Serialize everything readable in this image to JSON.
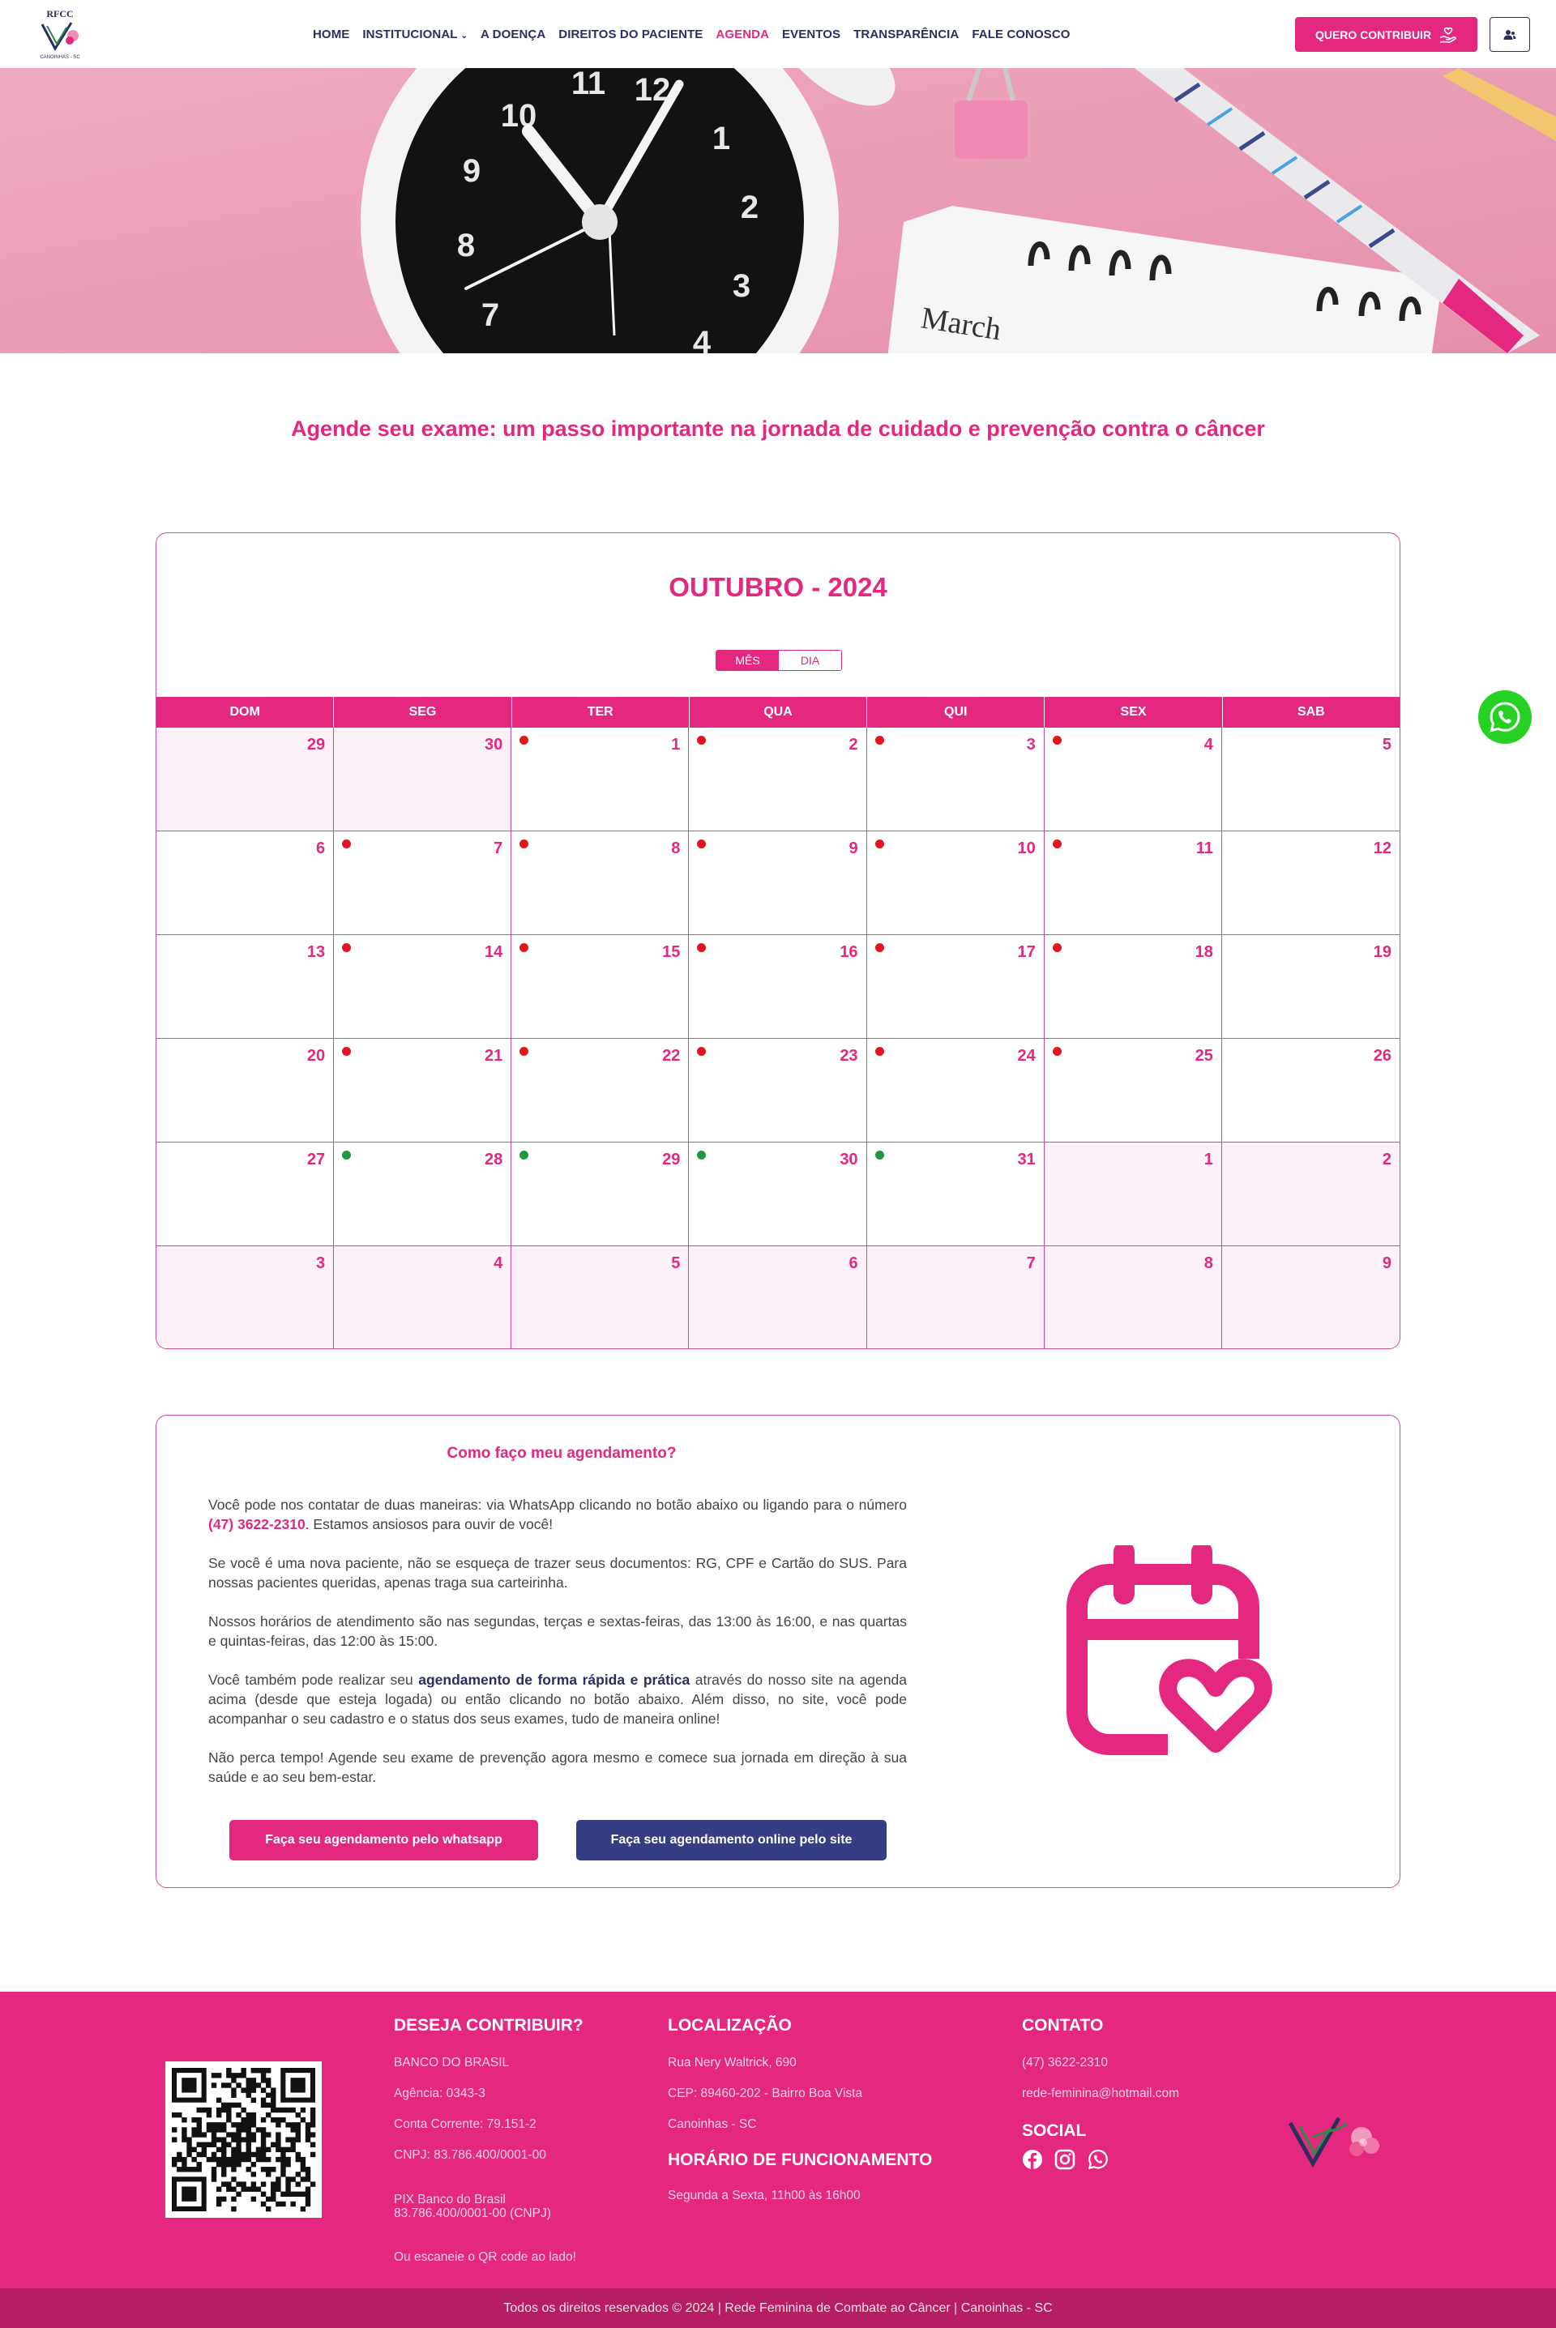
{
  "nav": {
    "items": [
      {
        "label": "HOME",
        "active": false,
        "has_dropdown": false
      },
      {
        "label": "INSTITUCIONAL",
        "active": false,
        "has_dropdown": true
      },
      {
        "label": "A DOENÇA",
        "active": false,
        "has_dropdown": false
      },
      {
        "label": "DIREITOS DO PACIENTE",
        "active": false,
        "has_dropdown": false
      },
      {
        "label": "AGENDA",
        "active": true,
        "has_dropdown": false
      },
      {
        "label": "EVENTOS",
        "active": false,
        "has_dropdown": false
      },
      {
        "label": "TRANSPARÊNCIA",
        "active": false,
        "has_dropdown": false
      },
      {
        "label": "FALE CONOSCO",
        "active": false,
        "has_dropdown": false
      }
    ],
    "contribute_label": "QUERO CONTRIBUIR"
  },
  "logo": {
    "text_top": "RFCC",
    "text_bottom": "CANOINHAS - SC"
  },
  "hero": {
    "calendar_month_text": "March"
  },
  "headline": "Agende seu exame: um passo importante na jornada de cuidado e prevenção contra o câncer",
  "calendar": {
    "title": "OUTUBRO - 2024",
    "views": [
      {
        "label": "MÊS",
        "active": true
      },
      {
        "label": "DIA",
        "active": false
      }
    ],
    "weekdays": [
      "DOM",
      "SEG",
      "TER",
      "QUA",
      "QUI",
      "SEX",
      "SAB"
    ],
    "dot_colors": {
      "red": "#e3141d",
      "green": "#1d9a3f"
    },
    "days": [
      {
        "n": "29",
        "muted": true,
        "dot": null
      },
      {
        "n": "30",
        "muted": true,
        "dot": null
      },
      {
        "n": "1",
        "muted": false,
        "dot": "red"
      },
      {
        "n": "2",
        "muted": false,
        "dot": "red"
      },
      {
        "n": "3",
        "muted": false,
        "dot": "red"
      },
      {
        "n": "4",
        "muted": false,
        "dot": "red"
      },
      {
        "n": "5",
        "muted": false,
        "dot": null
      },
      {
        "n": "6",
        "muted": false,
        "dot": null
      },
      {
        "n": "7",
        "muted": false,
        "dot": "red"
      },
      {
        "n": "8",
        "muted": false,
        "dot": "red"
      },
      {
        "n": "9",
        "muted": false,
        "dot": "red"
      },
      {
        "n": "10",
        "muted": false,
        "dot": "red"
      },
      {
        "n": "11",
        "muted": false,
        "dot": "red"
      },
      {
        "n": "12",
        "muted": false,
        "dot": null
      },
      {
        "n": "13",
        "muted": false,
        "dot": null
      },
      {
        "n": "14",
        "muted": false,
        "dot": "red"
      },
      {
        "n": "15",
        "muted": false,
        "dot": "red"
      },
      {
        "n": "16",
        "muted": false,
        "dot": "red"
      },
      {
        "n": "17",
        "muted": false,
        "dot": "red"
      },
      {
        "n": "18",
        "muted": false,
        "dot": "red"
      },
      {
        "n": "19",
        "muted": false,
        "dot": null
      },
      {
        "n": "20",
        "muted": false,
        "dot": null
      },
      {
        "n": "21",
        "muted": false,
        "dot": "red"
      },
      {
        "n": "22",
        "muted": false,
        "dot": "red"
      },
      {
        "n": "23",
        "muted": false,
        "dot": "red"
      },
      {
        "n": "24",
        "muted": false,
        "dot": "red"
      },
      {
        "n": "25",
        "muted": false,
        "dot": "red"
      },
      {
        "n": "26",
        "muted": false,
        "dot": null
      },
      {
        "n": "27",
        "muted": false,
        "dot": null
      },
      {
        "n": "28",
        "muted": false,
        "dot": "green"
      },
      {
        "n": "29",
        "muted": false,
        "dot": "green"
      },
      {
        "n": "30",
        "muted": false,
        "dot": "green"
      },
      {
        "n": "31",
        "muted": false,
        "dot": "green"
      },
      {
        "n": "1",
        "muted": true,
        "dot": null
      },
      {
        "n": "2",
        "muted": true,
        "dot": null
      },
      {
        "n": "3",
        "muted": true,
        "dot": null
      },
      {
        "n": "4",
        "muted": true,
        "dot": null
      },
      {
        "n": "5",
        "muted": true,
        "dot": null
      },
      {
        "n": "6",
        "muted": true,
        "dot": null
      },
      {
        "n": "7",
        "muted": true,
        "dot": null
      },
      {
        "n": "8",
        "muted": true,
        "dot": null
      },
      {
        "n": "9",
        "muted": true,
        "dot": null
      }
    ]
  },
  "info": {
    "title": "Como faço meu agendamento?",
    "p1_a": "Você pode nos contatar de duas maneiras: via WhatsApp clicando no botão abaixo ou ligando para o número ",
    "p1_phone": "(47) 3622-2310",
    "p1_b": ". Estamos ansiosos para ouvir de você!",
    "p2": "Se você é uma nova paciente, não se esqueça de trazer seus documentos: RG, CPF e Cartão do SUS. Para nossas pacientes queridas, apenas traga sua carteirinha.",
    "p3": "Nossos horários de atendimento são nas segundas, terças e sextas-feiras, das 13:00 às 16:00, e nas quartas e quintas-feiras, das 12:00 às 15:00.",
    "p4_a": "Você também pode realizar seu ",
    "p4_strong": "agendamento de forma rápida e prática",
    "p4_b": " através do nosso site na agenda acima (desde que esteja logada) ou então clicando no botão abaixo. Além disso, no site, você pode acompanhar o seu cadastro e o status dos seus exames, tudo de maneira online!",
    "p5": "Não perca tempo! Agende seu exame de prevenção agora mesmo e comece sua jornada em direção à sua saúde e ao seu bem-estar.",
    "btn_whatsapp": "Faça seu agendamento pelo whatsapp",
    "btn_site": "Faça seu agendamento online pelo site"
  },
  "footer": {
    "contrib": {
      "heading": "DESEJA CONTRIBUIR?",
      "bank": "BANCO DO BRASIL",
      "agency": "Agência: 0343-3",
      "account": "Conta Corrente: 79.151-2",
      "cnpj": "CNPJ: 83.786.400/0001-00",
      "pix_line1": "PIX Banco do Brasil",
      "pix_line2": "83.786.400/0001-00 (CNPJ)",
      "qr_note": "Ou escaneie o QR code ao lado!"
    },
    "location": {
      "heading": "LOCALIZAÇÃO",
      "street": "Rua Nery Waltrick, 690",
      "cep": "CEP: 89460-202 - Bairro Boa Vista",
      "city": "Canoinhas - SC"
    },
    "hours": {
      "heading": "HORÁRIO DE FUNCIONAMENTO",
      "text": "Segunda a Sexta, 11h00 às 16h00"
    },
    "contact": {
      "heading": "CONTATO",
      "phone": "(47) 3622-2310",
      "email": "rede-feminina@hotmail.com"
    },
    "social": {
      "heading": "SOCIAL",
      "icons": [
        "facebook-icon",
        "instagram-icon",
        "whatsapp-icon"
      ]
    },
    "copyright": "Todos os direitos reservados © 2024 | Rede Feminina de Combate ao Câncer | Canoinhas - SC"
  },
  "colors": {
    "brand_pink": "#e4277f",
    "navy": "#2b2f5e",
    "button_blue": "#363d84",
    "whatsapp_green": "#25d224"
  }
}
